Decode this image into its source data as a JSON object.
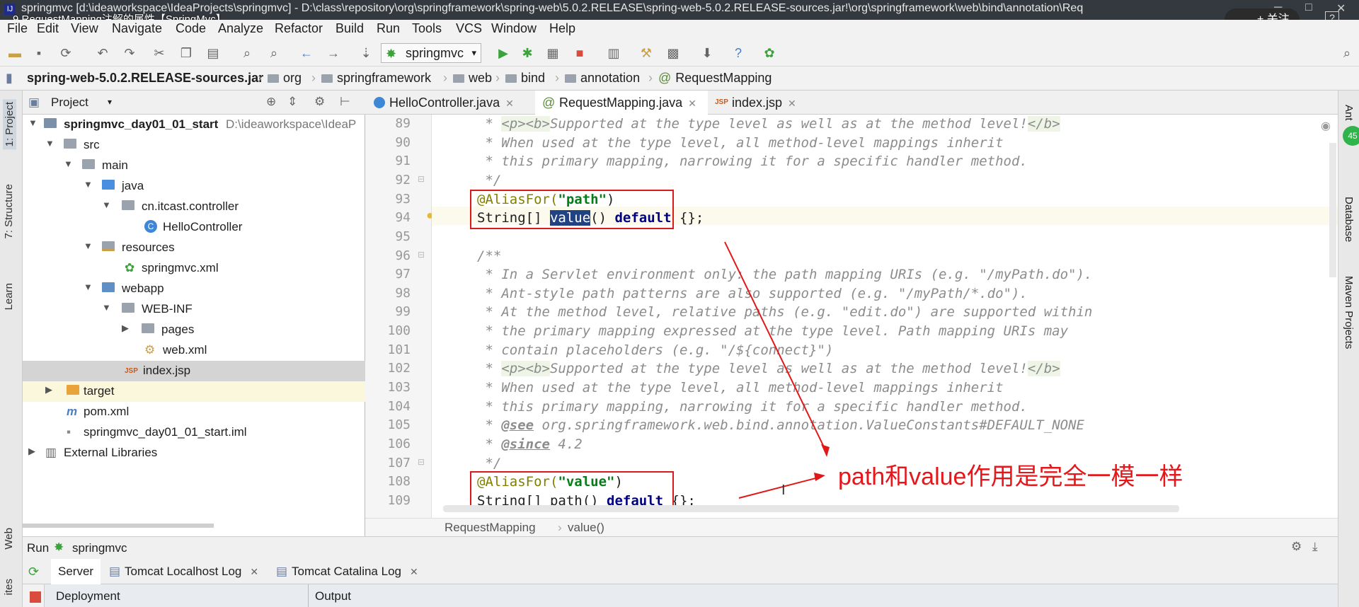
{
  "titlebar": {
    "title": "springmvc [d:\\ideaworkspace\\IdeaProjects\\springmvc] - D:\\class\\repository\\org\\springframework\\spring-web\\5.0.2.RELEASE\\spring-web-5.0.2.RELEASE-sources.jar!\\org\\springframework\\web\\bind\\annotation\\Req",
    "video_title": "9.RequestMapping注解的属性【SpringMvc】",
    "follow_label": "+ 关注"
  },
  "menu": [
    "File",
    "Edit",
    "View",
    "Navigate",
    "Code",
    "Analyze",
    "Refactor",
    "Build",
    "Run",
    "Tools",
    "VCS",
    "Window",
    "Help"
  ],
  "toolbar": {
    "run_config": "springmvc"
  },
  "breadcrumb": [
    "spring-web-5.0.2.RELEASE-sources.jar",
    "org",
    "springframework",
    "web",
    "bind",
    "annotation",
    "RequestMapping"
  ],
  "left_tools": [
    "1: Project",
    "7: Structure",
    "Learn",
    "Web",
    "ites"
  ],
  "right_tools": [
    "Ant",
    "Database",
    "Maven Projects"
  ],
  "project": {
    "header": "Project",
    "tree": [
      {
        "label": "springmvc_day01_01_start",
        "path": "D:\\ideaworkspace\\IdeaP"
      },
      {
        "label": "src"
      },
      {
        "label": "main"
      },
      {
        "label": "java"
      },
      {
        "label": "cn.itcast.controller"
      },
      {
        "label": "HelloController"
      },
      {
        "label": "resources"
      },
      {
        "label": "springmvc.xml"
      },
      {
        "label": "webapp"
      },
      {
        "label": "WEB-INF"
      },
      {
        "label": "pages"
      },
      {
        "label": "web.xml"
      },
      {
        "label": "index.jsp"
      },
      {
        "label": "target"
      },
      {
        "label": "pom.xml"
      },
      {
        "label": "springmvc_day01_01_start.iml"
      },
      {
        "label": "External Libraries"
      }
    ]
  },
  "tabs": [
    "HelloController.java",
    "RequestMapping.java",
    "index.jsp"
  ],
  "code": {
    "line_numbers": [
      "89",
      "90",
      "91",
      "92",
      "93",
      "94",
      "95",
      "96",
      "97",
      "98",
      "99",
      "100",
      "101",
      "102",
      "103",
      "104",
      "105",
      "106",
      "107",
      "108",
      "109"
    ],
    "l89_a": " * ",
    "l89_tag1": "<p><b>",
    "l89_b": "Supported at the type level as well as at the method level!",
    "l89_tag2": "</b>",
    "l90": " * When used at the type level, all method-level mappings inherit",
    "l91": " * this primary mapping, narrowing it for a specific handler method.",
    "l92": " */",
    "l93_ann": "@AliasFor(",
    "l93_str": "\"path\"",
    "l93_end": ")",
    "l94_a": "String[] ",
    "l94_sel": "value",
    "l94_b": "() ",
    "l94_kw": "default",
    "l94_c": " {};",
    "l96": "/**",
    "l97": " * In a Servlet environment only: the path mapping URIs (e.g. \"/myPath.do\").",
    "l98": " * Ant-style path patterns are also supported (e.g. \"/myPath/*.do\").",
    "l99": " * At the method level, relative paths (e.g. \"edit.do\") are supported within",
    "l100": " * the primary mapping expressed at the type level. Path mapping URIs may",
    "l101": " * contain placeholders (e.g. \"/${connect}\")",
    "l102_a": " * ",
    "l102_tag1": "<p><b>",
    "l102_b": "Supported at the type level as well as at the method level!",
    "l102_tag2": "</b>",
    "l103": " * When used at the type level, all method-level mappings inherit",
    "l104": " * this primary mapping, narrowing it for a specific handler method.",
    "l105_a": " * ",
    "l105_tag": "@see",
    "l105_b": " org.springframework.web.bind.annotation.ValueConstants#DEFAULT_NONE",
    "l106_a": " * ",
    "l106_tag": "@since",
    "l106_b": " 4.2",
    "l107": " */",
    "l108_ann": "@AliasFor(",
    "l108_str": "\"value\"",
    "l108_end": ")",
    "l109_a": "String[] path() ",
    "l109_kw": "default",
    "l109_c": " {};"
  },
  "editor_crumbs": [
    "RequestMapping",
    "value()"
  ],
  "annotation": "path和value作用是完全一模一样",
  "run": {
    "label": "Run",
    "config": "springmvc",
    "tabs": [
      "Server",
      "Tomcat Localhost Log",
      "Tomcat Catalina Log"
    ],
    "columns": [
      "Deployment",
      "Output"
    ]
  }
}
